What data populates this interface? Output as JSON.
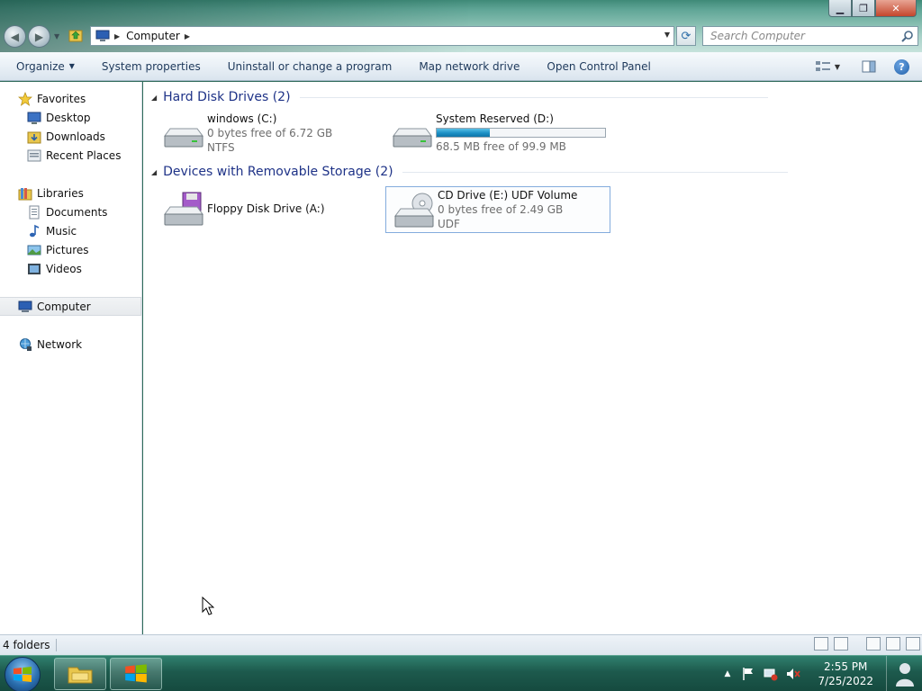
{
  "window": {
    "controls": {
      "minimize_icon": "minimize-icon",
      "maximize_icon": "maximize-icon",
      "close_icon": "close-icon"
    }
  },
  "addressbar": {
    "crumbs": [
      "Computer"
    ],
    "search_placeholder": "Search Computer"
  },
  "toolbar": {
    "organize": "Organize",
    "system_properties": "System properties",
    "uninstall": "Uninstall or change a program",
    "map_drive": "Map network drive",
    "control_panel": "Open Control Panel"
  },
  "navpane": {
    "favorites": {
      "label": "Favorites",
      "items": [
        {
          "label": "Desktop"
        },
        {
          "label": "Downloads"
        },
        {
          "label": "Recent Places"
        }
      ]
    },
    "libraries": {
      "label": "Libraries",
      "items": [
        {
          "label": "Documents"
        },
        {
          "label": "Music"
        },
        {
          "label": "Pictures"
        },
        {
          "label": "Videos"
        }
      ]
    },
    "computer": "Computer",
    "network": "Network"
  },
  "content": {
    "groups": [
      {
        "title": "Hard Disk Drives (2)",
        "items": [
          {
            "name": "windows (C:)",
            "free": "0 bytes free of 6.72 GB",
            "fs": "NTFS",
            "icon": "hard-drive-icon"
          },
          {
            "name": "System Reserved (D:)",
            "free": "68.5 MB free of 99.9 MB",
            "used_fraction": 0.314,
            "icon": "hard-drive-icon"
          }
        ]
      },
      {
        "title": "Devices with Removable Storage (2)",
        "items": [
          {
            "name": "Floppy Disk Drive (A:)",
            "icon": "floppy-drive-icon"
          },
          {
            "name": "CD Drive (E:) UDF Volume",
            "free": "0 bytes free of 2.49 GB",
            "fs": "UDF",
            "icon": "cd-drive-icon",
            "selected": true
          }
        ]
      }
    ]
  },
  "statusbar": {
    "text": "4 folders"
  },
  "taskbar": {
    "time": "2:55 PM",
    "date": "7/25/2022"
  },
  "colors": {
    "accent": "#1e3287",
    "capacity_bar": "#1a8fc4",
    "selection_border": "#84acdd"
  }
}
